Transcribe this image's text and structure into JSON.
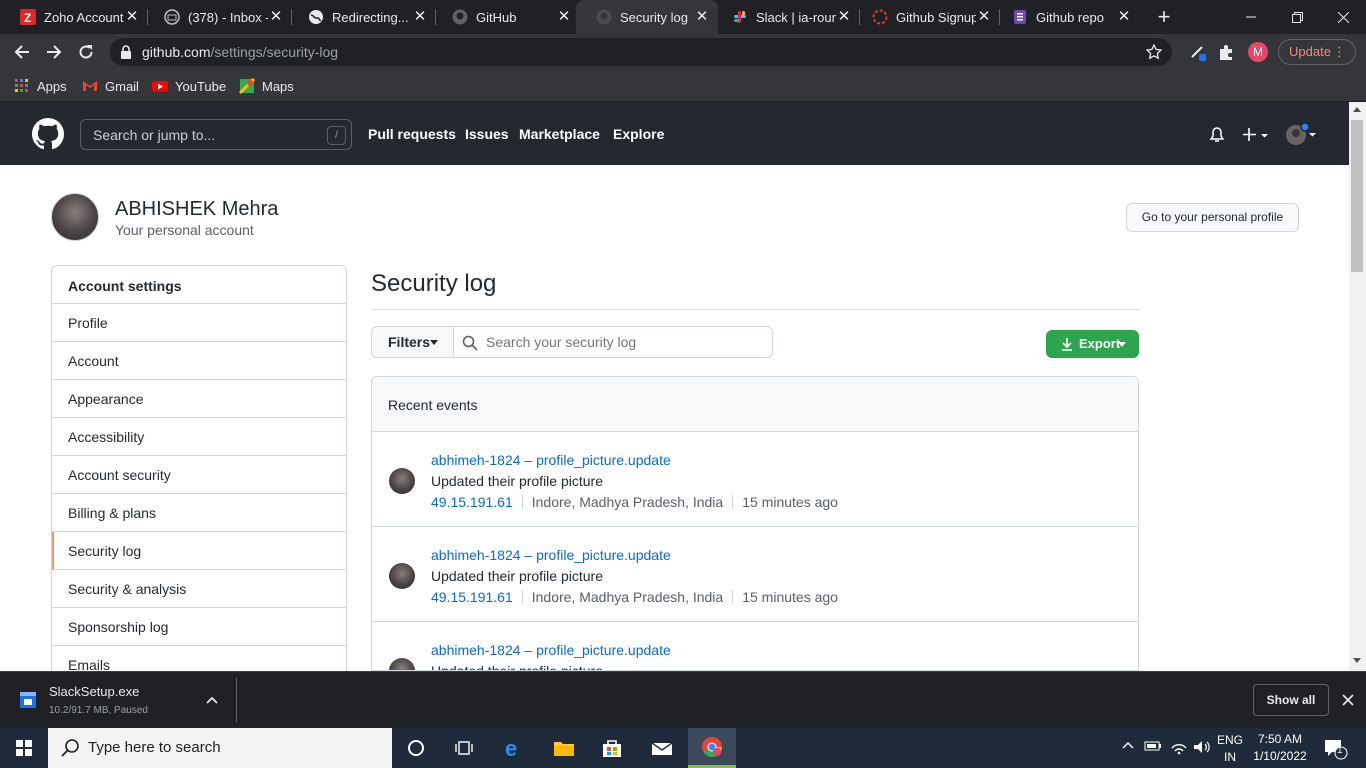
{
  "browser": {
    "tabs": [
      {
        "title": "Zoho Accounts",
        "icon": "zoho-icon",
        "color": "#e42527"
      },
      {
        "title": "(378) - Inbox -",
        "icon": "mail-icon",
        "color": "#c0c0c0"
      },
      {
        "title": "Redirecting...",
        "icon": "globe-icon",
        "color": "#e8eaed"
      },
      {
        "title": "GitHub",
        "icon": "github-icon",
        "color": "#e8eaed"
      },
      {
        "title": "Security log",
        "icon": "github-icon",
        "color": "#5f6368",
        "active": true
      },
      {
        "title": "Slack | ia-round",
        "icon": "slack-icon",
        "color": "#e01e5a"
      },
      {
        "title": "Github Signup",
        "icon": "spinner-icon",
        "color": "#e53935"
      },
      {
        "title": "Github repo",
        "icon": "forms-icon",
        "color": "#7248b9"
      }
    ],
    "url_host": "github.com",
    "url_path": "/settings/security-log",
    "update_label": "Update",
    "profile_initial": "M",
    "bookmarks": [
      {
        "label": "Apps",
        "icon": "apps-grid-icon"
      },
      {
        "label": "Gmail",
        "icon": "gmail-icon"
      },
      {
        "label": "YouTube",
        "icon": "youtube-icon"
      },
      {
        "label": "Maps",
        "icon": "maps-icon"
      }
    ]
  },
  "github": {
    "search_placeholder": "Search or jump to...",
    "search_shortcut": "/",
    "nav": [
      "Pull requests",
      "Issues",
      "Marketplace",
      "Explore"
    ],
    "user_name": "ABHISHEK Mehra",
    "user_sub": "Your personal account",
    "profile_button": "Go to your personal profile",
    "menu_header": "Account settings",
    "menu_items": [
      "Profile",
      "Account",
      "Appearance",
      "Accessibility",
      "Account security",
      "Billing & plans",
      "Security log",
      "Security & analysis",
      "Sponsorship log",
      "Emails"
    ],
    "selected_menu": "Security log",
    "page_title": "Security log",
    "filters_label": "Filters",
    "search_log_placeholder": "Search your security log",
    "export_label": "Export",
    "events_header": "Recent events",
    "events": [
      {
        "user": "abhimeh-1824",
        "sep": "–",
        "action": "profile_picture.update",
        "desc": "Updated their profile picture",
        "ip": "49.15.191.61",
        "location": "Indore, Madhya Pradesh, India",
        "time": "15 minutes ago"
      },
      {
        "user": "abhimeh-1824",
        "sep": "–",
        "action": "profile_picture.update",
        "desc": "Updated their profile picture",
        "ip": "49.15.191.61",
        "location": "Indore, Madhya Pradesh, India",
        "time": "15 minutes ago"
      },
      {
        "user": "abhimeh-1824",
        "sep": "–",
        "action": "profile_picture.update",
        "desc": "Updated their profile picture",
        "ip": "",
        "location": "",
        "time": ""
      }
    ]
  },
  "downloads": {
    "file_name": "SlackSetup.exe",
    "status": "10.2/91.7 MB, Paused",
    "show_all": "Show all"
  },
  "taskbar": {
    "search_placeholder": "Type here to search",
    "lang_top": "ENG",
    "lang_bottom": "IN",
    "time": "7:50 AM",
    "date": "1/10/2022",
    "notifications": "1"
  }
}
